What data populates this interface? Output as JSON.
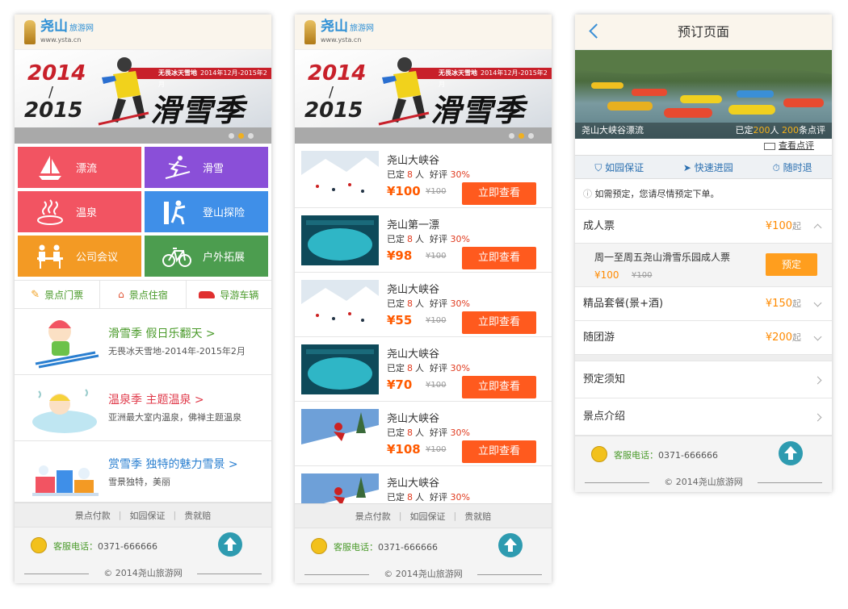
{
  "logo": {
    "title": "尧山",
    "subtitle": "旅游网",
    "url": "www.ysta.cn"
  },
  "banner": {
    "year1": "2014",
    "slash": "/",
    "year2": "2015",
    "ribbon_brand": "无畏冰天雪地",
    "ribbon_dates": "2014年12月-2015年2月",
    "season": "滑雪季"
  },
  "categories": [
    {
      "label": "漂流",
      "color": "#f25462",
      "icon": "sailboat-icon"
    },
    {
      "label": "滑雪",
      "color": "#8a4fd8",
      "icon": "skier-icon"
    },
    {
      "label": "温泉",
      "color": "#f25462",
      "icon": "hot-spring-icon"
    },
    {
      "label": "登山探险",
      "color": "#3f8fe8",
      "icon": "climber-icon"
    },
    {
      "label": "公司会议",
      "color": "#f39a24",
      "icon": "meeting-icon"
    },
    {
      "label": "户外拓展",
      "color": "#4c9d4f",
      "icon": "bicycle-icon"
    }
  ],
  "quick_links": [
    {
      "label": "景点门票",
      "icon": "ticket-icon"
    },
    {
      "label": "景点住宿",
      "icon": "house-icon"
    },
    {
      "label": "导游车辆",
      "icon": "car-icon"
    }
  ],
  "promos": [
    {
      "title": "滑雪季  假日乐翻天",
      "subtitle": "无畏冰天雪地-2014年-2015年2月",
      "color": "#4a9a2a"
    },
    {
      "title": "温泉季  主题温泉",
      "subtitle": "亚洲最大室内温泉，佛禅主题温泉",
      "color": "#e03a4a"
    },
    {
      "title": "赏雪季  独特的魅力雪景",
      "subtitle": "雪景独特，美丽",
      "color": "#2a7fd0"
    }
  ],
  "footer": {
    "links": [
      "景点付款",
      "如园保证",
      "贵就赔"
    ],
    "separator": "|",
    "phone_label": "客服电话：",
    "phone": "0371-666666",
    "copyright": "2014尧山旅游网"
  },
  "listing": {
    "booked_prefix": "已定",
    "people_unit": "人",
    "rating_label": "好评",
    "button_label": "立即查看",
    "items": [
      {
        "name": "尧山大峡谷",
        "count": "8",
        "rating": "30%",
        "price": "¥100",
        "old": "¥100",
        "thumb": "snow"
      },
      {
        "name": "尧山第一漂",
        "count": "8",
        "rating": "30%",
        "price": "¥98",
        "old": "¥100",
        "thumb": "pool"
      },
      {
        "name": "尧山大峡谷",
        "count": "8",
        "rating": "30%",
        "price": "¥55",
        "old": "¥100",
        "thumb": "snow"
      },
      {
        "name": "尧山大峡谷",
        "count": "8",
        "rating": "30%",
        "price": "¥70",
        "old": "¥100",
        "thumb": "pool"
      },
      {
        "name": "尧山大峡谷",
        "count": "8",
        "rating": "30%",
        "price": "¥108",
        "old": "¥100",
        "thumb": "ski"
      },
      {
        "name": "尧山大峡谷",
        "count": "8",
        "rating": "30%",
        "price": "",
        "old": "",
        "thumb": "ski"
      }
    ]
  },
  "booking": {
    "title": "预订页面",
    "photo_caption": "尧山大峡谷漂流",
    "booked_prefix": "已定",
    "booked_count": "200",
    "booked_unit": "人",
    "review_count": "200",
    "review_unit": "条点评",
    "view_reviews": "查看点评",
    "guarantees": [
      "如园保证",
      "快速进园",
      "随时退"
    ],
    "notice": "如需预定，您请尽情预定下单。",
    "adult_ticket": {
      "label": "成人票",
      "price": "¥100",
      "suffix": "起"
    },
    "sub_ticket": {
      "title": "周一至周五尧山滑雪乐园成人票",
      "price": "¥100",
      "old": "¥100",
      "button": "预定"
    },
    "package": {
      "label": "精品套餐(景+酒)",
      "price": "¥150",
      "suffix": "起"
    },
    "group": {
      "label": "随团游",
      "price": "¥200",
      "suffix": "起"
    },
    "notes": "预定须知",
    "intro": "景点介绍"
  }
}
